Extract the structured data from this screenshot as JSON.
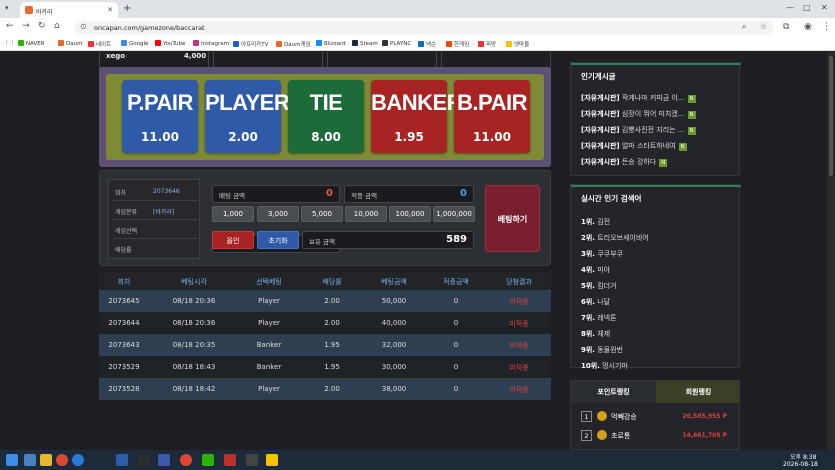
{
  "browser": {
    "tab_title": "바카라",
    "url": "oncapan.com/gamezone/baccarat",
    "bookmarks": [
      "NAVER",
      "Daum",
      "네이트",
      "Google",
      "YouTube",
      "Instagram",
      "아프리카TV",
      "Daum게임",
      "Blizzard",
      "Steam",
      "PLAYNC",
      "넥슨",
      "한게임",
      "피망",
      "넷마블"
    ]
  },
  "top_boxes": [
    {
      "name": "xego",
      "amount": "4,000"
    },
    {
      "name": "",
      "amount": ""
    },
    {
      "name": "",
      "amount": ""
    },
    {
      "name": "",
      "amount": ""
    }
  ],
  "bet_cards": [
    {
      "name": "P.PAIR",
      "odds": "11.00",
      "color": "#2f5aa8"
    },
    {
      "name": "PLAYER",
      "odds": "2.00",
      "color": "#2f5aa8"
    },
    {
      "name": "TIE",
      "odds": "8.00",
      "color": "#1e6b3a"
    },
    {
      "name": "BANKER",
      "odds": "1.95",
      "color": "#a82424"
    },
    {
      "name": "B.PAIR",
      "odds": "11.00",
      "color": "#a82424"
    }
  ],
  "game_info": {
    "round_label": "회차",
    "round_value": "2073646",
    "category_label": "게임분류",
    "category_value": "[바카라]",
    "choice_label": "게임선택",
    "choice_value": "",
    "odds_label": "배당률",
    "odds_value": ""
  },
  "bet_amount": {
    "label": "배팅 금액",
    "value": "0"
  },
  "win_amount": {
    "label": "적중 금액",
    "value": "0"
  },
  "chips": [
    "1,000",
    "3,000",
    "5,000",
    "10,000",
    "100,000",
    "1,000,000"
  ],
  "allin_label": "올인",
  "reset_label": "초기화",
  "balance": {
    "label": "보유 금액",
    "value": "589"
  },
  "bet_button": "베팅하기",
  "history": {
    "headers": [
      "회차",
      "베팅시각",
      "선택베팅",
      "배당률",
      "베팅금액",
      "적중금액",
      "당첨결과"
    ],
    "rows": [
      [
        "2073645",
        "08/18 20:36",
        "Player",
        "2.00",
        "50,000",
        "0",
        "미적중"
      ],
      [
        "2073644",
        "08/18 20:36",
        "Player",
        "2.00",
        "40,000",
        "0",
        "미적중"
      ],
      [
        "2073643",
        "08/18 20:35",
        "Banker",
        "1.95",
        "32,000",
        "0",
        "미적중"
      ],
      [
        "2073529",
        "08/18 18:43",
        "Banker",
        "1.95",
        "30,000",
        "0",
        "미적중"
      ],
      [
        "2073528",
        "08/18 18:42",
        "Player",
        "2.00",
        "38,000",
        "0",
        "미적중"
      ]
    ]
  },
  "popular_posts": {
    "title": "인기게시글",
    "items": [
      {
        "board": "[자유게시판]",
        "text": "작게나마 커피금 이...",
        "badge": "N"
      },
      {
        "board": "[자유게시판]",
        "text": "심장이 뛰어 미치겠...",
        "badge": "N"
      },
      {
        "board": "[자유게시판]",
        "text": "김뿡사진전 지리는 ...",
        "badge": "N"
      },
      {
        "board": "[자유게시판]",
        "text": "얼마 스타트하네여",
        "badge": "N"
      },
      {
        "board": "[자유게시판]",
        "text": "든승 강하다",
        "badge": "N"
      }
    ]
  },
  "realtime_search": {
    "title": "실시간 인기 검색어",
    "items": [
      {
        "rank": "1위.",
        "word": "김전"
      },
      {
        "rank": "2위.",
        "word": "트리오브세이비어"
      },
      {
        "rank": "3위.",
        "word": "쿠쿠부쿠"
      },
      {
        "rank": "4위.",
        "word": "미아"
      },
      {
        "rank": "5위.",
        "word": "킴더거"
      },
      {
        "rank": "6위.",
        "word": "나달"
      },
      {
        "rank": "7위.",
        "word": "레넥톤"
      },
      {
        "rank": "8위.",
        "word": "체제"
      },
      {
        "rank": "9위.",
        "word": "동물원번"
      },
      {
        "rank": "10위.",
        "word": "멍시기마"
      }
    ]
  },
  "ranking": {
    "tab_point": "포인트랭킹",
    "tab_member": "회원랭킹",
    "items": [
      {
        "rank": "1",
        "name": "먹빼강승",
        "points": "20,585,955 P"
      },
      {
        "rank": "2",
        "name": "초로통",
        "points": "14,661,705 P"
      }
    ]
  },
  "taskbar": {
    "time": "오후 8:38",
    "date": "2026-08-18"
  }
}
